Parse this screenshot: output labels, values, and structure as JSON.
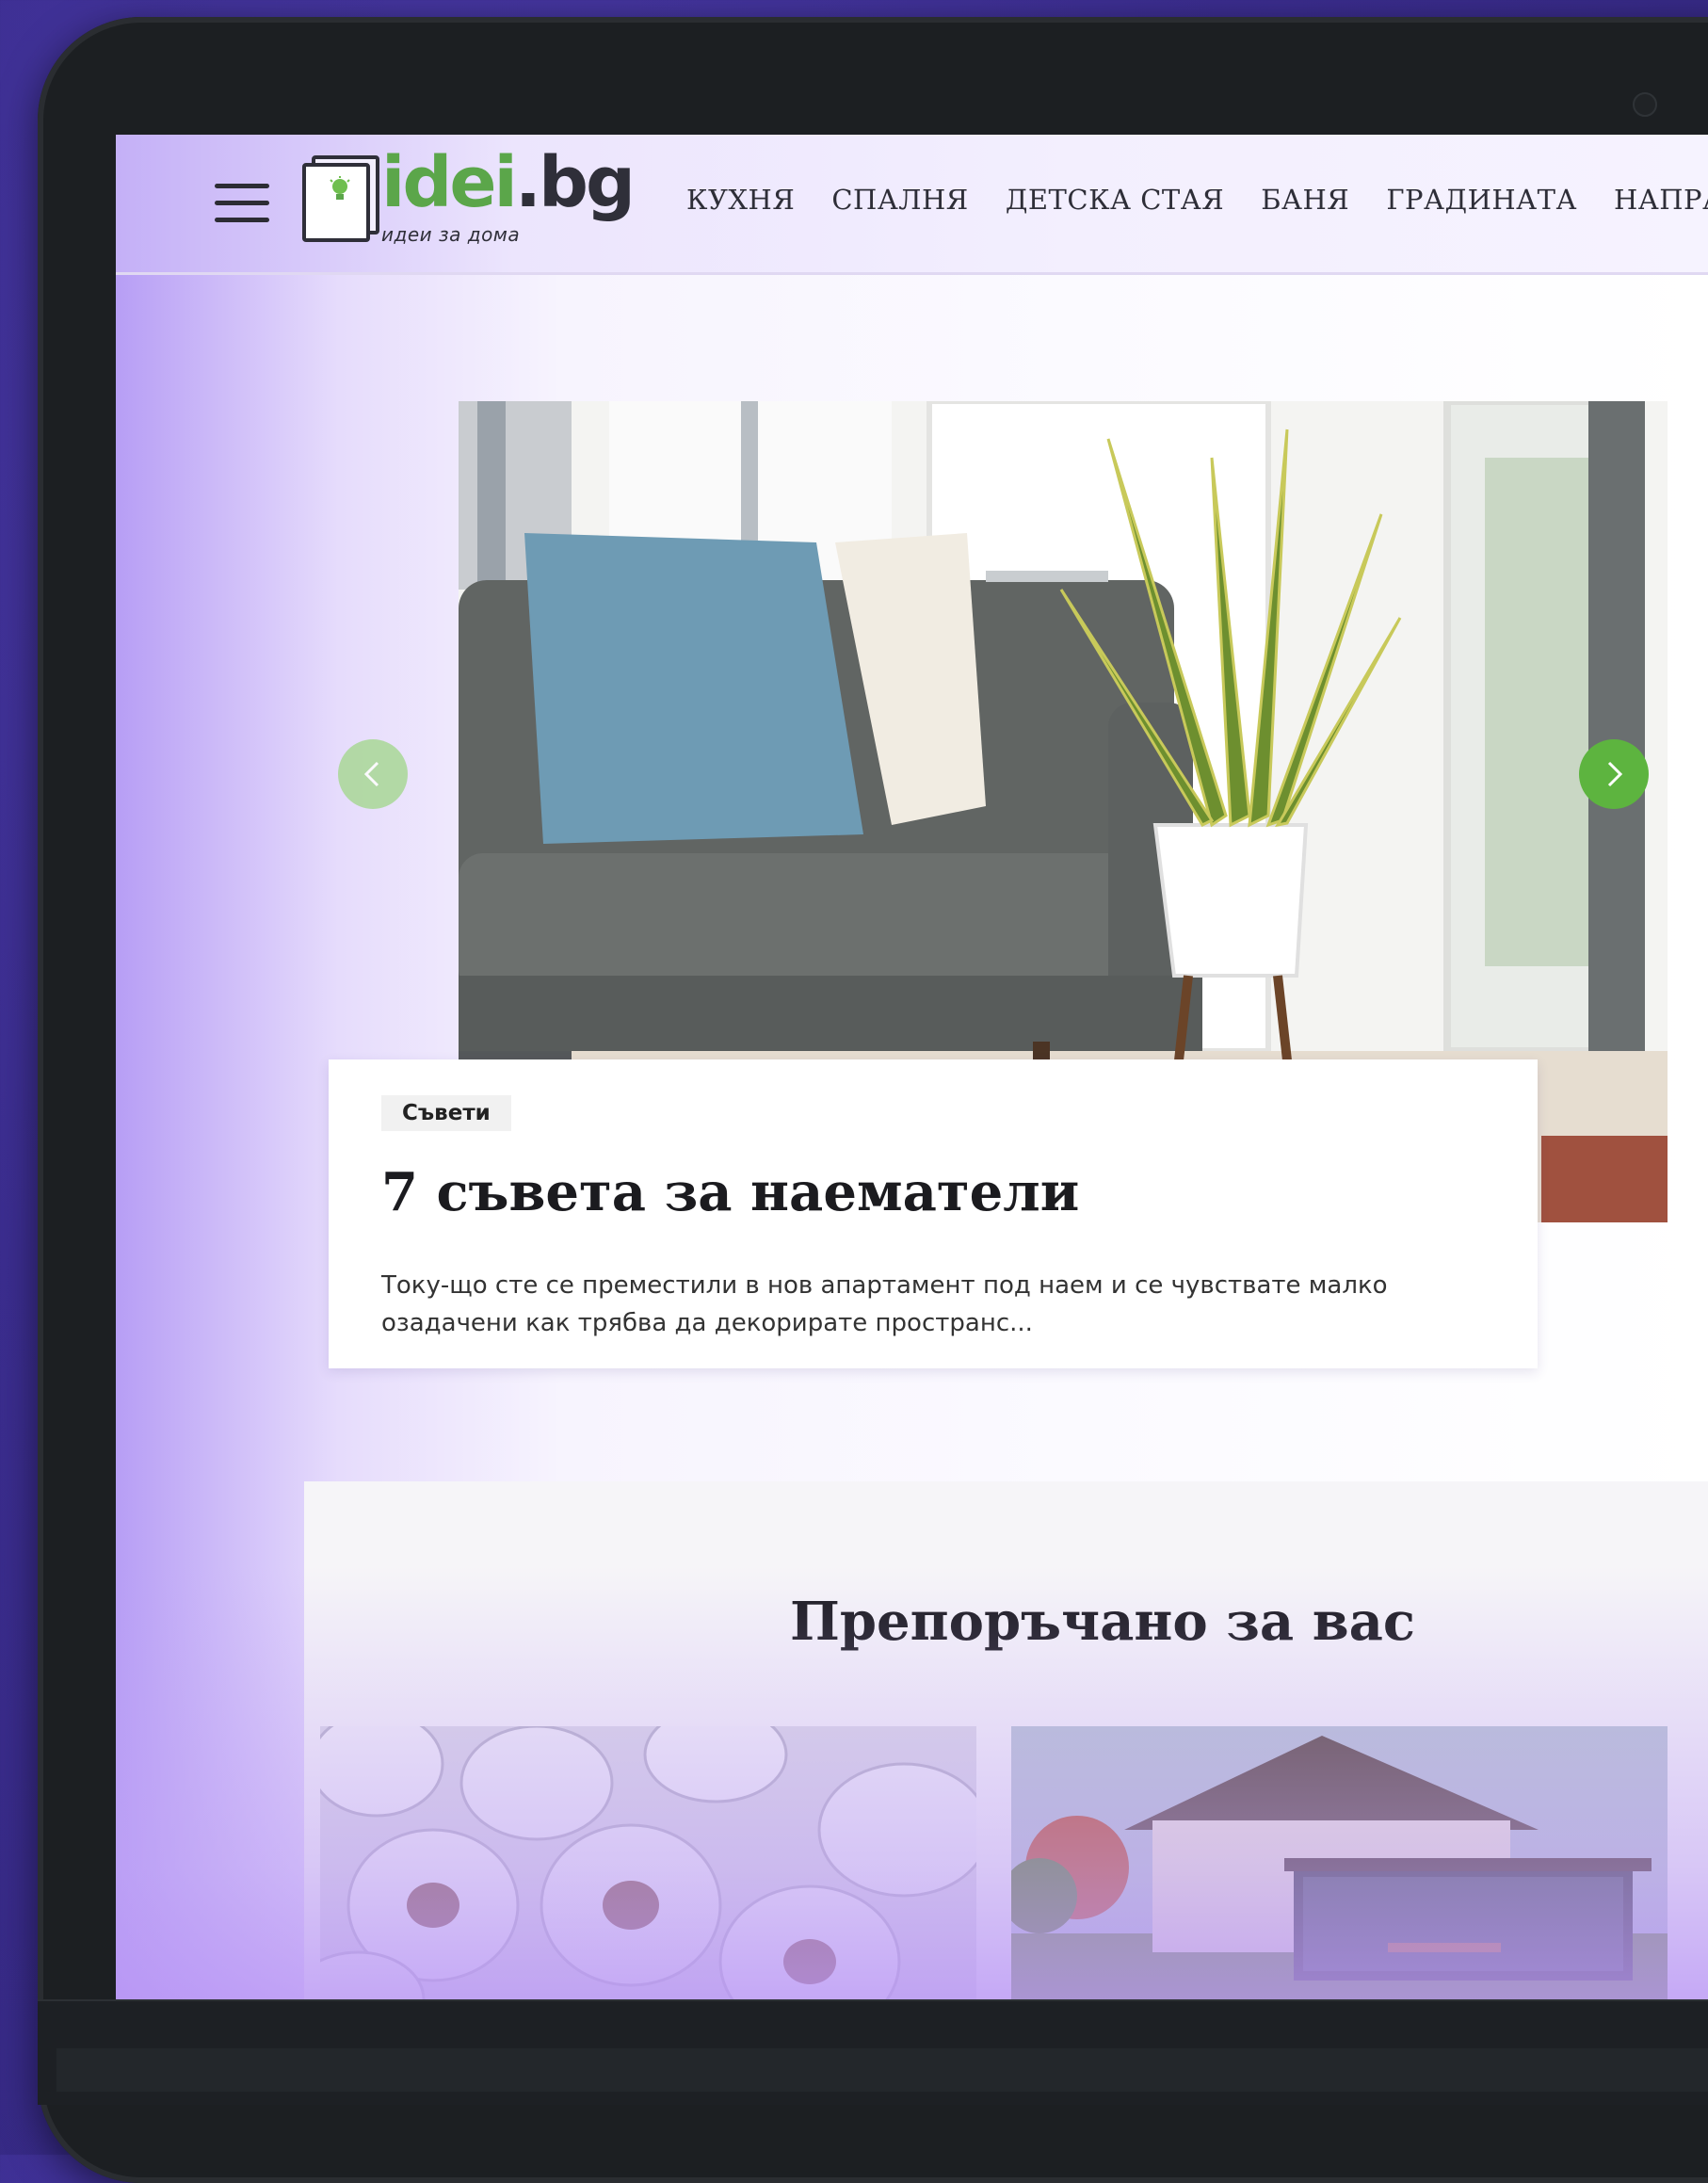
{
  "site": {
    "logo_main_a": "idei",
    "logo_main_b": ".bg",
    "logo_sub": "идеи за дома"
  },
  "nav": {
    "items": [
      {
        "label": "КУХНЯ"
      },
      {
        "label": "СПАЛНЯ"
      },
      {
        "label": "ДЕТСКА СТАЯ"
      },
      {
        "label": "БАНЯ"
      },
      {
        "label": "ГРАДИНАТА"
      },
      {
        "label": "НАПРАВИ СИ САМ"
      }
    ]
  },
  "slider": {
    "tag": "Съвети",
    "title": "7 съвета за наематели",
    "excerpt": "Току-що сте се преместили в нов апартамент под наем и се чувствате малко озадачени как трябва да декорирате пространс..."
  },
  "recommended": {
    "title": "Препоръчано за вас"
  },
  "colors": {
    "accent_green": "#5db43f",
    "logo_green": "#5ba64a",
    "header_purple": "#c4b0f7"
  }
}
